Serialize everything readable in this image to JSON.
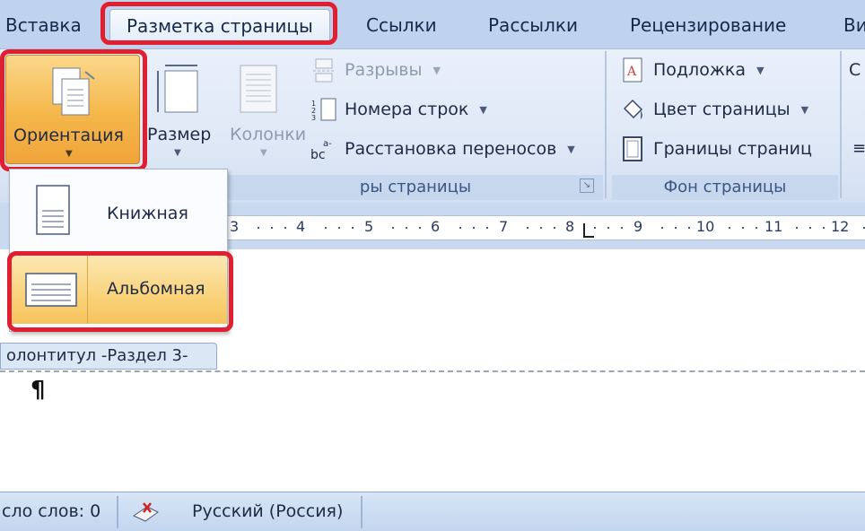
{
  "tabs": [
    "Вставка",
    "Разметка страницы",
    "Ссылки",
    "Рассылки",
    "Рецензирование",
    "Ви"
  ],
  "ribbon": {
    "page_setup": {
      "orientation_label": "Ориентация",
      "size_label": "Размер",
      "columns_label": "Колонки",
      "breaks_label": "Разрывы",
      "line_numbers_label": "Номера строк",
      "hyphenation_label": "Расстановка переносов",
      "group_caption": "ры страницы"
    },
    "page_background": {
      "watermark_label": "Подложка",
      "page_color_label": "Цвет страницы",
      "page_borders_label": "Границы страниц",
      "group_caption": "Фон страницы"
    },
    "next_group_partial": "С"
  },
  "orientation_menu": {
    "items": [
      "Книжная",
      "Альбомная"
    ],
    "selected": "Альбомная"
  },
  "ruler": {
    "numbers": [
      "3",
      "4",
      "5",
      "6",
      "7",
      "8",
      "9",
      "10",
      "11",
      "12"
    ]
  },
  "document": {
    "header_tag": "олонтитул -Раздел 3-",
    "cursor_mark": "¶"
  },
  "status_bar": {
    "word_count": "сло слов: 0",
    "language": "Русский (Россия)"
  },
  "colors": {
    "highlight_red": "#e02030",
    "active_orange": "#f5b74a",
    "ribbon_blue": "#dfe8f6"
  }
}
